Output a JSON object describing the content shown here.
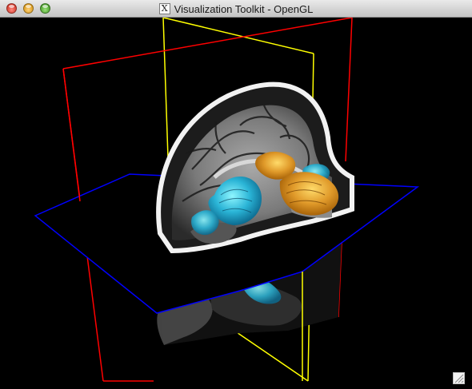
{
  "window": {
    "title": "Visualization Toolkit - OpenGL",
    "title_icon_glyph": "X",
    "controls": {
      "close": "close-button",
      "minimize": "minimize-button",
      "zoom": "zoom-button"
    }
  },
  "scene": {
    "background": "#000000",
    "plane_colors": {
      "sagittal_outline": "#ff0000",
      "axial_outline": "#0000ff",
      "coronal_outline": "#ffff00"
    },
    "structure_colors": {
      "ventricle": "#2ab4d6",
      "ventricle_deep": "#0c6a8f",
      "corpus_callosum": "#e09a2a",
      "thalamus": "#c97a12",
      "thalamus_highlight": "#ffdb6a"
    }
  },
  "icons": {
    "window_icon": "x11-icon",
    "grip_icon": "resize-grip-icon"
  }
}
